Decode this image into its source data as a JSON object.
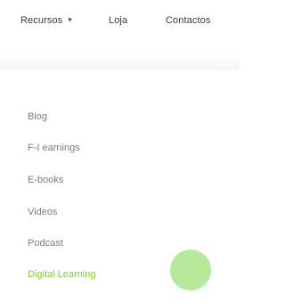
{
  "nav": {
    "recursos_label": "Recursos",
    "recursos_caret": "▾",
    "loja_label": "Loja",
    "contactos_label": "Contactos"
  },
  "dropdown": {
    "items": [
      {
        "label": "Blog"
      },
      {
        "label": "F-I earnings"
      },
      {
        "label": "E-books"
      },
      {
        "label": "Videos"
      },
      {
        "label": "Podcast"
      },
      {
        "label": "Digital Learning"
      }
    ],
    "active_item": "Digital Learning"
  },
  "colors": {
    "accent": "#7fcf3a",
    "circle": "#b6e99a",
    "text": "#3a3a3a",
    "muted_text": "#7d7d7d"
  }
}
